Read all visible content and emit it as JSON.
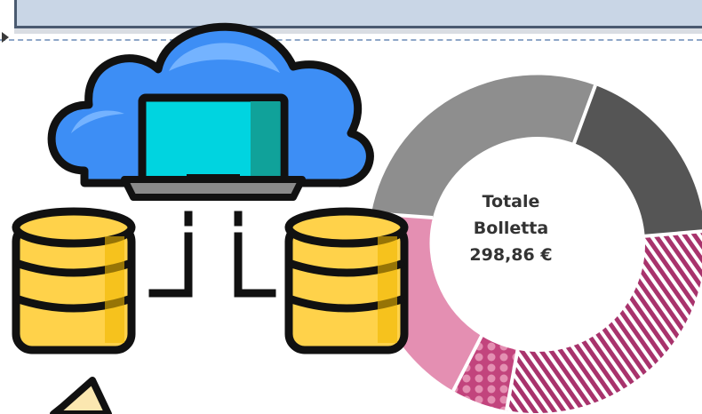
{
  "donut": {
    "center_line1": "Totale",
    "center_line2": "Bolletta",
    "center_line3": "298,86 €"
  },
  "colors": {
    "cloud_blue": "#3d8ef5",
    "cloud_light": "#74b3ff",
    "screen_cyan": "#00d4e0",
    "coin_yellow": "#ffd24a",
    "coin_dark": "#f0b800",
    "donut_gray": "#8e8e8e",
    "donut_dark": "#555555",
    "donut_magenta": "#a8336c",
    "donut_pink": "#e48fb2",
    "outline": "#111111"
  },
  "icons": [
    "cloud-laptop-icon",
    "database-icon",
    "database-icon",
    "paper-icon"
  ]
}
